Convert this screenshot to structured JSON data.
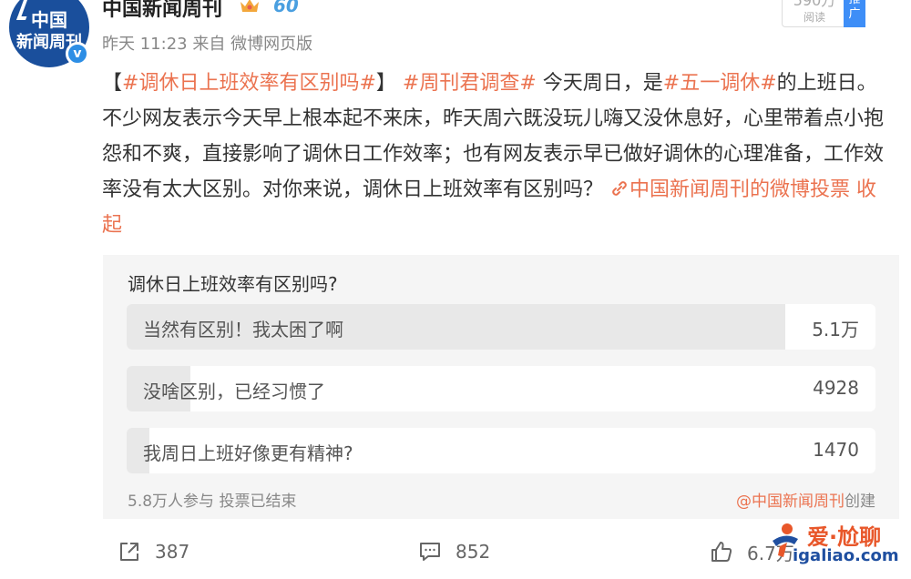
{
  "account": {
    "name": "中国新闻周刊",
    "avatar_lines": [
      "中国",
      "新闻周刊"
    ],
    "badge": "60",
    "verified_mark": "v"
  },
  "meta": {
    "time": "昨天 11:23",
    "source": "来自 微博网页版"
  },
  "read_count": {
    "value": "590万",
    "label": "阅读",
    "promo_label": "推广"
  },
  "post": {
    "segments": [
      {
        "text": "【",
        "highlight": false
      },
      {
        "text": "#调休日上班效率有区别吗#",
        "highlight": true
      },
      {
        "text": "】 ",
        "highlight": false
      },
      {
        "text": "#周刊君调查#",
        "highlight": true
      },
      {
        "text": " 今天周日，是",
        "highlight": false
      },
      {
        "text": "#五一调休#",
        "highlight": true
      },
      {
        "text": "的上班日。不少网友表示今天早上根本起不来床，昨天周六既没玩儿嗨又没休息好，心里带着点小抱怨和不爽，直接影响了调休日工作效率；也有网友表示早已做好调休的心理准备，工作效率没有太大区别。对你来说，调休日上班效率有区别吗？ ",
        "highlight": false
      }
    ],
    "poll_link": "中国新闻周刊的微博投票",
    "collapse": "收起"
  },
  "poll": {
    "question": "调休日上班效率有区别吗?",
    "options": [
      {
        "label": "当然有区别！我太困了啊",
        "count": "5.1万",
        "share": 0.88
      },
      {
        "label": "没啥区别，已经习惯了",
        "count": "4928",
        "share": 0.085
      },
      {
        "label": "我周日上班好像更有精神?",
        "count": "1470",
        "share": 0.03
      }
    ],
    "participants": "5.8万人参与",
    "status": "投票已结束",
    "creator": "@中国新闻周刊",
    "creator_suffix": "创建"
  },
  "actions": {
    "share": "387",
    "comment": "852",
    "like": "6.7万"
  },
  "watermark": {
    "top": "爱·尬聊",
    "bottom": "igaliao.com"
  },
  "colors": {
    "highlight": "#eb7350",
    "promo": "#3e8ef7",
    "avatar_bg": "#1a4f9c"
  }
}
